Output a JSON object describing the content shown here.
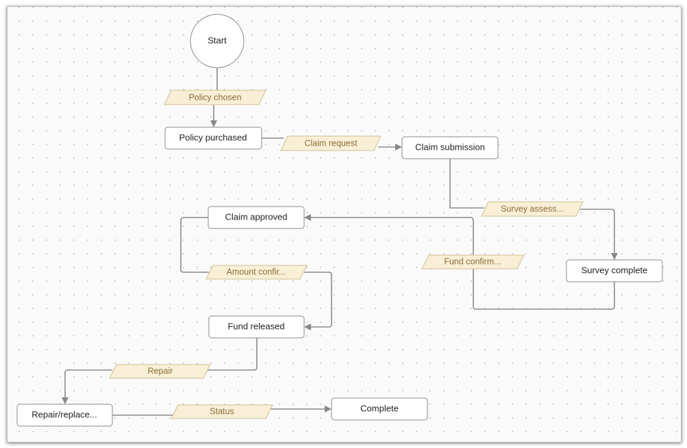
{
  "nodes": {
    "start": "Start",
    "policy_purchased": "Policy purchased",
    "claim_submission": "Claim submission",
    "survey_complete": "Survey complete",
    "claim_approved": "Claim approved",
    "fund_released": "Fund released",
    "repair_replace": "Repair/replace...",
    "complete": "Complete"
  },
  "transitions": {
    "policy_chosen": "Policy chosen",
    "claim_request": "Claim request",
    "survey_assess": "Survey assess...",
    "fund_confirm": "Fund confirm...",
    "amount_confirm": "Amount confir...",
    "repair": "Repair",
    "status": "Status"
  },
  "colors": {
    "transition_fill": "#f8efd6",
    "transition_text": "#8a6d3b",
    "edge": "#8a8a8a"
  }
}
